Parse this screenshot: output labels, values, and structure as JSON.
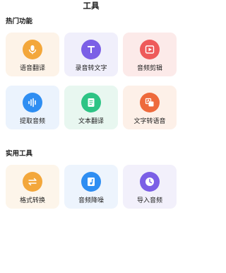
{
  "header": {
    "title": "工具"
  },
  "sections": {
    "hot": {
      "title": "热门功能"
    },
    "practical": {
      "title": "实用工具"
    }
  },
  "hot_items": [
    {
      "label": "语音翻译",
      "icon": "microphone-icon",
      "bg": "#fdf3e8",
      "color": "#f3a73b"
    },
    {
      "label": "录音转文字",
      "icon": "letter-t-icon",
      "bg": "#f0effb",
      "color": "#7b5fe6"
    },
    {
      "label": "音频剪辑",
      "icon": "audio-cut-icon",
      "bg": "#fceae9",
      "color": "#ee5a5a"
    },
    {
      "label": "提取音频",
      "icon": "waveform-icon",
      "bg": "#ebf3fd",
      "color": "#2f8ef2"
    },
    {
      "label": "文本翻译",
      "icon": "document-icon",
      "bg": "#e8f7f0",
      "color": "#2ec485"
    },
    {
      "label": "文字转语音",
      "icon": "text-to-speech-icon",
      "bg": "#fdf0e8",
      "color": "#ee6a3c"
    }
  ],
  "tool_items": [
    {
      "label": "格式转换",
      "icon": "swap-arrows-icon",
      "bg": "#fdf5ea",
      "color": "#f3a73b"
    },
    {
      "label": "音频降噪",
      "icon": "music-file-icon",
      "bg": "#edf4fd",
      "color": "#2f8ef2"
    },
    {
      "label": "导入音频",
      "icon": "clock-icon",
      "bg": "#f2f0fb",
      "color": "#7b5fe6"
    }
  ]
}
